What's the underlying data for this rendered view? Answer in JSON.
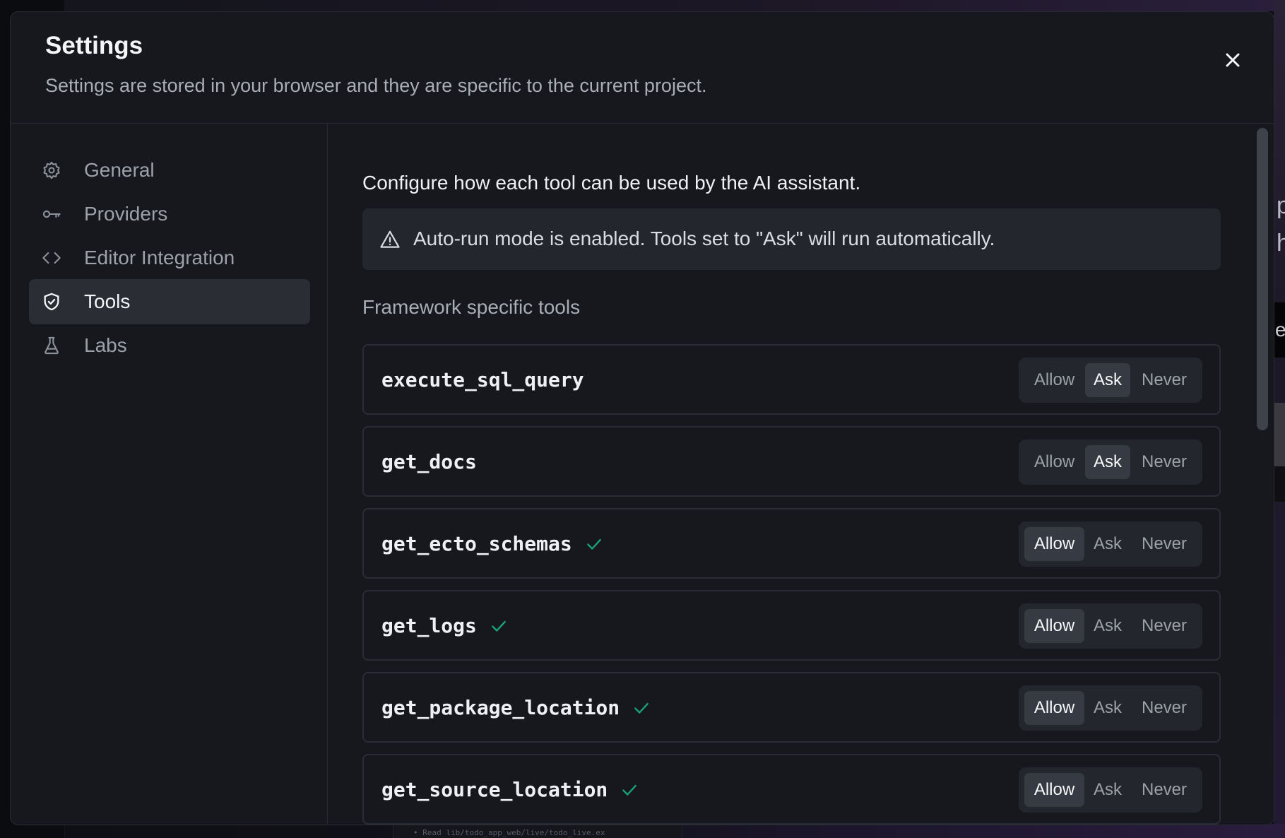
{
  "modal": {
    "title": "Settings",
    "description": "Settings are stored in your browser and they are specific to the current project."
  },
  "sidebar": {
    "items": [
      {
        "label": "General",
        "icon": "gear-icon",
        "active": false
      },
      {
        "label": "Providers",
        "icon": "key-icon",
        "active": false
      },
      {
        "label": "Editor Integration",
        "icon": "code-icon",
        "active": false
      },
      {
        "label": "Tools",
        "icon": "shield-check-icon",
        "active": true
      },
      {
        "label": "Labs",
        "icon": "flask-icon",
        "active": false
      }
    ]
  },
  "content": {
    "intro": "Configure how each tool can be used by the AI assistant.",
    "alert": "Auto-run mode is enabled. Tools set to \"Ask\" will run automatically.",
    "section_title": "Framework specific tools",
    "options": [
      "Allow",
      "Ask",
      "Never"
    ],
    "tools": [
      {
        "name": "execute_sql_query",
        "selected": "Ask",
        "checked": false
      },
      {
        "name": "get_docs",
        "selected": "Ask",
        "checked": false
      },
      {
        "name": "get_ecto_schemas",
        "selected": "Allow",
        "checked": true
      },
      {
        "name": "get_logs",
        "selected": "Allow",
        "checked": true
      },
      {
        "name": "get_package_location",
        "selected": "Allow",
        "checked": true
      },
      {
        "name": "get_source_location",
        "selected": "Allow",
        "checked": true
      }
    ]
  },
  "background": {
    "right_glyphs": [
      "p",
      "h",
      "e"
    ],
    "bottom_text": "• Read lib/todo_app_web/live/todo_live.ex"
  },
  "colors": {
    "modal_bg": "#16181d",
    "border": "#272a30",
    "active_nav": "#2a2d34",
    "check_green": "#1aa37a"
  }
}
